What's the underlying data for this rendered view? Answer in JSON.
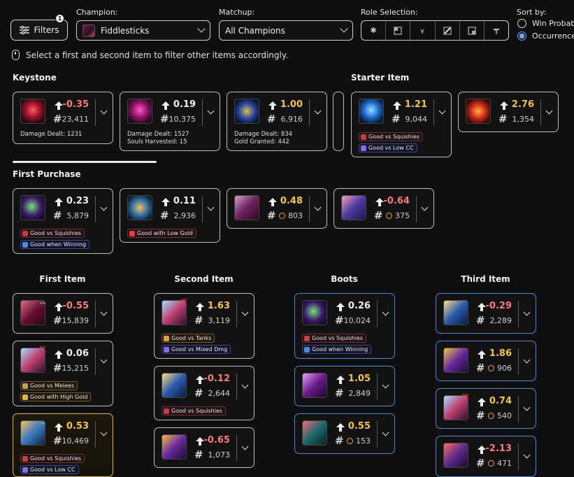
{
  "header": {
    "filters_label": "Filters",
    "filters_badge": "1",
    "champion_label": "Champion:",
    "champion_value": "Fiddlesticks",
    "matchup_label": "Matchup:",
    "matchup_value": "All Champions",
    "role_label": "Role Selection:",
    "roles": [
      "all-roles-icon",
      "top-icon",
      "jungle-icon",
      "mid-icon",
      "bot-icon",
      "support-icon"
    ],
    "sort_label": "Sort by:",
    "sort_options": [
      {
        "label": "Win Probability",
        "selected": false
      },
      {
        "label": "Occurrence",
        "selected": true
      }
    ]
  },
  "hint": "Select a first and second item to filter other items accordingly.",
  "sections": {
    "keystone": "Keystone",
    "starter": "Starter Item",
    "first_purchase": "First Purchase",
    "first_item": "First Item",
    "second_item": "Second Item",
    "boots": "Boots",
    "third_item": "Third Item"
  },
  "keystone": [
    {
      "value": "-0.35",
      "count": "23,411",
      "stats": [
        "Damage Dealt: 1231"
      ]
    },
    {
      "value": "0.19",
      "count": "10,375",
      "stats": [
        "Damage Dealt: 1527",
        "Souls Harvested: 15"
      ]
    },
    {
      "value": "1.00",
      "count": "6,916",
      "stats": [
        "Damage Dealt: 834",
        "Gold Granted: 442"
      ]
    }
  ],
  "starter": [
    {
      "value": "1.21",
      "count": "9,044",
      "tags": [
        "Good vs Squishies",
        "Good vs Low CC"
      ]
    },
    {
      "value": "2.76",
      "count": "1,354",
      "tags": []
    }
  ],
  "first_purchase": [
    {
      "value": "0.23",
      "count": "5,879",
      "tags": [
        "Good vs Squishies",
        "Good when Winning"
      ]
    },
    {
      "value": "0.11",
      "count": "2,936",
      "tags": [
        "Good with Low Gold"
      ]
    },
    {
      "value": "0.48",
      "count": "803",
      "tags": []
    },
    {
      "value": "-0.64",
      "count": "375",
      "tags": []
    }
  ],
  "first_item": [
    {
      "value": "-0.55",
      "count": "15,839",
      "tags": []
    },
    {
      "value": "0.06",
      "count": "15,215",
      "tags": [
        "Good vs Melees",
        "Good with High Gold"
      ]
    },
    {
      "value": "0.53",
      "count": "10,469",
      "tags": [
        "Good vs Squishies",
        "Good vs Low CC"
      ]
    }
  ],
  "second_item": [
    {
      "value": "1.63",
      "count": "3,119",
      "tags": [
        "Good vs Tanks",
        "Good vs Mixed Dmg"
      ]
    },
    {
      "value": "-0.12",
      "count": "2,644",
      "tags": [
        "Good vs Squishies"
      ]
    },
    {
      "value": "-0.65",
      "count": "1,073",
      "tags": []
    }
  ],
  "boots": [
    {
      "value": "0.26",
      "count": "10,024",
      "tags": [
        "Good vs Squishies",
        "Good when Winning"
      ]
    },
    {
      "value": "1.05",
      "count": "2,849",
      "tags": []
    },
    {
      "value": "0.55",
      "count": "153",
      "tags": []
    }
  ],
  "third_item": [
    {
      "value": "-0.29",
      "count": "2,289",
      "tags": []
    },
    {
      "value": "1.86",
      "count": "906",
      "tags": []
    },
    {
      "value": "0.74",
      "count": "540",
      "tags": []
    },
    {
      "value": "-2.13",
      "count": "471",
      "tags": []
    }
  ],
  "colors": {
    "positive": "#f0f0f0",
    "negative": "#ff7c7c",
    "gold": "#f4c646",
    "accent": "#4f86d6"
  }
}
